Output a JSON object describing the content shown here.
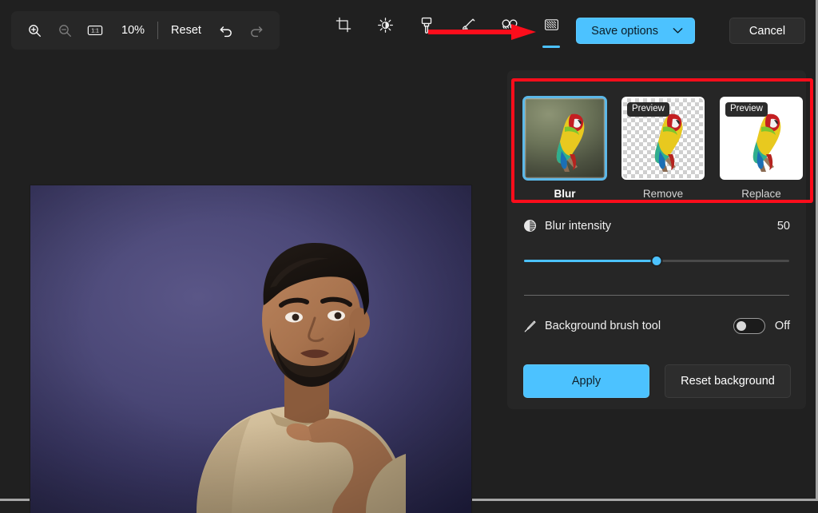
{
  "toolbar": {
    "zoom_in_icon": "zoom-in-icon",
    "zoom_out_icon": "zoom-out-icon",
    "actual_size_icon": "one-to-one-icon",
    "zoom_level": "10%",
    "reset_label": "Reset",
    "undo_icon": "undo-icon",
    "redo_icon": "redo-icon",
    "tools": [
      {
        "name": "crop",
        "icon": "crop-icon",
        "selected": false
      },
      {
        "name": "adjustment",
        "icon": "brightness-icon",
        "selected": false
      },
      {
        "name": "markup",
        "icon": "marker-pen-icon",
        "selected": false
      },
      {
        "name": "erase",
        "icon": "generative-erase-icon",
        "selected": false
      },
      {
        "name": "blur",
        "icon": "blur-faces-icon",
        "selected": false
      },
      {
        "name": "background",
        "icon": "background-removal-icon",
        "selected": true
      }
    ],
    "save_label": "Save options",
    "save_chevron_icon": "chevron-down-icon",
    "cancel_label": "Cancel"
  },
  "canvas": {
    "image_alt": "Portrait photo of a man pointing, purple studio backdrop"
  },
  "background_panel": {
    "options": [
      {
        "label": "Blur",
        "selected": true,
        "badge": null,
        "style": "blurred-photo"
      },
      {
        "label": "Remove",
        "selected": false,
        "badge": "Preview",
        "style": "transparent-checker"
      },
      {
        "label": "Replace",
        "selected": false,
        "badge": "Preview",
        "style": "white-fill"
      }
    ],
    "intensity": {
      "icon": "blur-intensity-icon",
      "label": "Blur intensity",
      "value": "50",
      "percent": 50,
      "min": 0,
      "max": 100
    },
    "brush": {
      "icon": "brush-pen-icon",
      "label": "Background brush tool",
      "state": "Off",
      "on": false
    },
    "apply_label": "Apply",
    "reset_background_label": "Reset background"
  },
  "annotations": {
    "arrow_color": "#fc0d1b",
    "box_color": "#fc0d1b"
  }
}
